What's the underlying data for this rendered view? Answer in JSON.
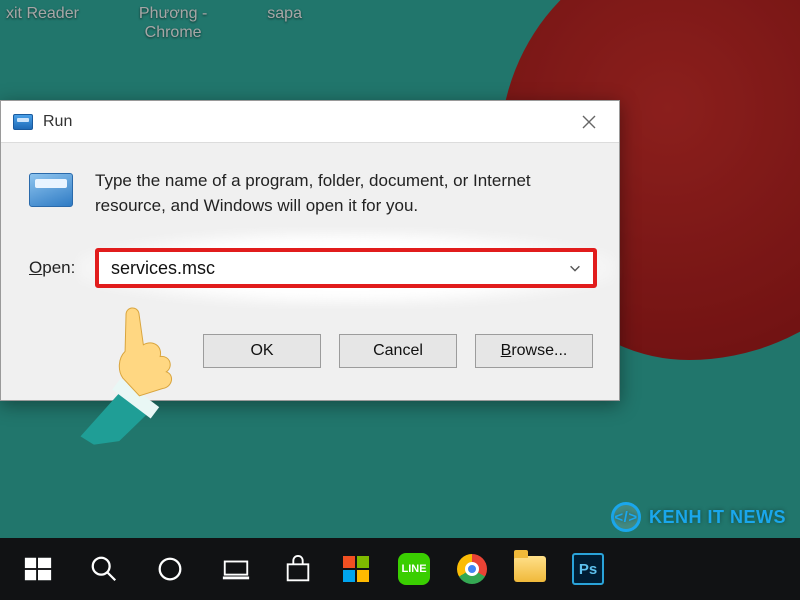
{
  "desktop": {
    "icons": [
      "xit Reader",
      "Phương -\nChrome",
      "sapa"
    ]
  },
  "run_dialog": {
    "title": "Run",
    "description": "Type the name of a program, folder, document, or Internet resource, and Windows will open it for you.",
    "open_label": "Open:",
    "open_accesskey": "O",
    "input_value": "services.msc",
    "buttons": {
      "ok": "OK",
      "cancel": "Cancel",
      "browse": "Browse...",
      "browse_accesskey": "B"
    }
  },
  "taskbar": {
    "items": [
      {
        "name": "start",
        "label": "Start"
      },
      {
        "name": "search",
        "label": "Search"
      },
      {
        "name": "cortana",
        "label": "Cortana"
      },
      {
        "name": "task-view",
        "label": "Task View"
      },
      {
        "name": "store",
        "label": "Microsoft Store"
      },
      {
        "name": "ms-store-tiles",
        "label": "Microsoft"
      },
      {
        "name": "line",
        "label": "LINE"
      },
      {
        "name": "chrome",
        "label": "Google Chrome"
      },
      {
        "name": "file-explorer",
        "label": "File Explorer"
      },
      {
        "name": "photoshop",
        "label": "Adobe Photoshop",
        "badge": "Ps"
      }
    ]
  },
  "watermark": {
    "logo_text": "</>",
    "text": "KENH IT NEWS"
  },
  "colors": {
    "highlight_border": "#e11c1c",
    "taskbar_bg": "#111214",
    "wallpaper_bg": "#33b5a6"
  }
}
